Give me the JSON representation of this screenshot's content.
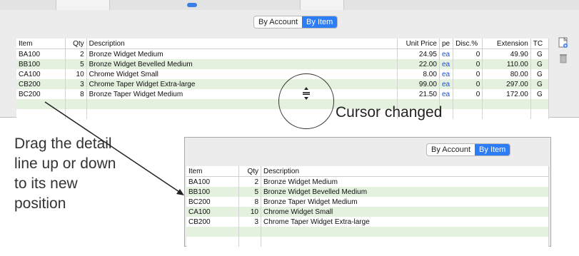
{
  "segment": {
    "left": "By Account",
    "right": "By Item"
  },
  "columns": [
    "Item",
    "Qty",
    "Description",
    "Unit Price",
    "pe",
    "Disc.%",
    "Extension",
    "TC"
  ],
  "top_rows": [
    {
      "item": "BA100",
      "qty": "2",
      "desc": "Bronze Widget Medium",
      "price": "24.95",
      "per": "ea",
      "disc": "0",
      "ext": "49.90",
      "tc": "G"
    },
    {
      "item": "BB100",
      "qty": "5",
      "desc": "Bronze Widget Bevelled Medium",
      "price": "22.00",
      "per": "ea",
      "disc": "0",
      "ext": "110.00",
      "tc": "G"
    },
    {
      "item": "CA100",
      "qty": "10",
      "desc": "Chrome Widget Small",
      "price": "8.00",
      "per": "ea",
      "disc": "0",
      "ext": "80.00",
      "tc": "G"
    },
    {
      "item": "CB200",
      "qty": "3",
      "desc": "Chrome Taper Widget Extra-large",
      "price": "99.00",
      "per": "ea",
      "disc": "0",
      "ext": "297.00",
      "tc": "G"
    },
    {
      "item": "BC200",
      "qty": "8",
      "desc": "Bronze Taper Widget Medium",
      "price": "21.50",
      "per": "ea",
      "disc": "0",
      "ext": "172.00",
      "tc": "G"
    }
  ],
  "bottom_rows": [
    {
      "item": "BA100",
      "qty": "2",
      "desc": "Bronze Widget Medium"
    },
    {
      "item": "BB100",
      "qty": "5",
      "desc": "Bronze Widget Bevelled Medium"
    },
    {
      "item": "BC200",
      "qty": "8",
      "desc": "Bronze Taper Widget Medium"
    },
    {
      "item": "CA100",
      "qty": "10",
      "desc": "Chrome Widget Small"
    },
    {
      "item": "CB200",
      "qty": "3",
      "desc": "Chrome Taper Widget Extra-large"
    }
  ],
  "annotations": {
    "cursor_changed": "Cursor changed",
    "drag_line1": "Drag the detail",
    "drag_line2": "line up or down",
    "drag_line3": "to its new",
    "drag_line4": "position"
  }
}
